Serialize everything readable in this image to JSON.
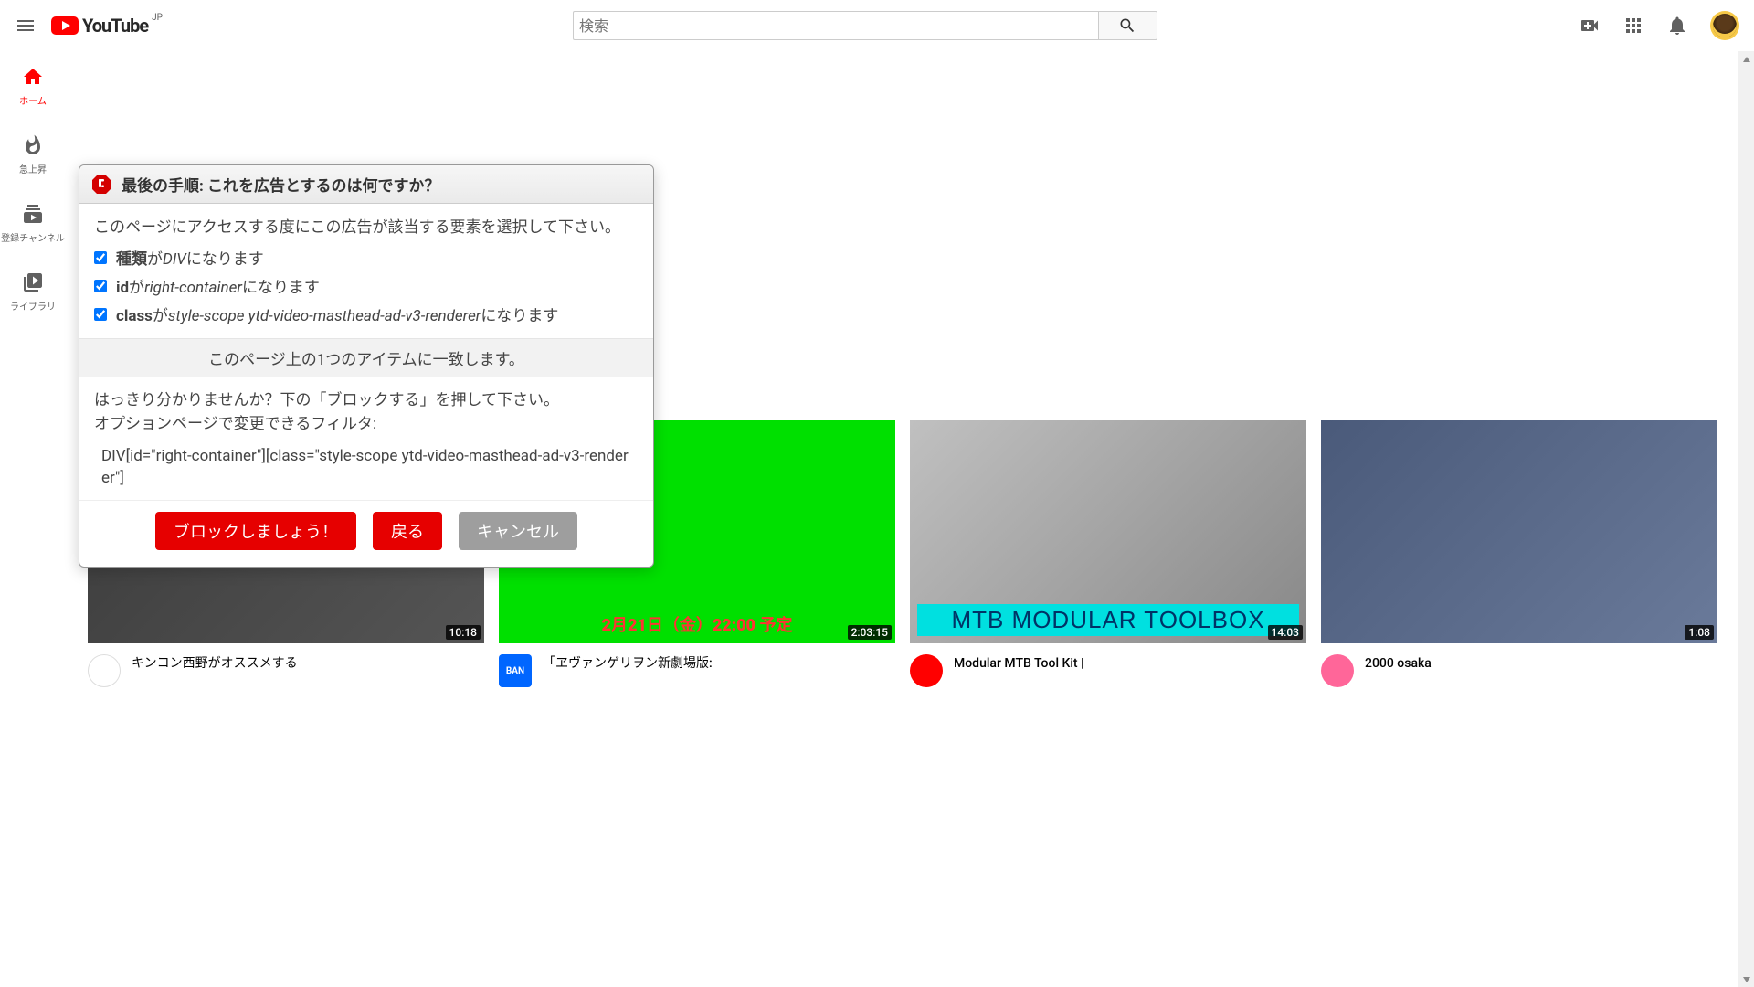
{
  "header": {
    "brand": "YouTube",
    "country": "JP",
    "search_placeholder": "検索"
  },
  "sidebar": {
    "items": [
      {
        "label": "ホーム"
      },
      {
        "label": "急上昇"
      },
      {
        "label": "登録チャンネル"
      },
      {
        "label": "ライブラリ"
      }
    ]
  },
  "videos": [
    {
      "title": "キンコン西野がオススメする",
      "duration": "10:18",
      "badge": ""
    },
    {
      "title": "「ヱヴァンゲリヲン新劇場版:",
      "duration": "2:03:15",
      "badge": "BAN",
      "promo": "2月21日（金）22:00 予定"
    },
    {
      "title": "Modular MTB Tool Kit |",
      "duration": "14:03",
      "overlay": "MTB MODULAR TOOLBOX"
    },
    {
      "title": "2000 osaka",
      "duration": "1:08"
    }
  ],
  "dialog": {
    "title": "最後の手順: これを広告とするのは何ですか？",
    "instruction": "このページにアクセスする度にこの広告が該当する要素を選択して下さい。",
    "checks": [
      {
        "strong": "種類",
        "mid": "が",
        "ital": "DIV",
        "tail": "になります"
      },
      {
        "strong": "id",
        "mid": "が",
        "ital": "right-container",
        "tail": "になります"
      },
      {
        "strong": "class",
        "mid": "が",
        "ital": "style-scope ytd-video-masthead-ad-v3-renderer",
        "tail": "になります"
      }
    ],
    "match": "このページ上の1つのアイテムに一致します。",
    "help1": "はっきり分かりませんか？下の「ブロックする」を押して下さい。",
    "help2": "オプションページで変更できるフィルタ:",
    "filter": "DIV[id=\"right-container\"][class=\"style-scope ytd-video-masthead-ad-v3-renderer\"]",
    "buttons": {
      "block": "ブロックしましょう！",
      "back": "戻る",
      "cancel": "キャンセル"
    }
  }
}
